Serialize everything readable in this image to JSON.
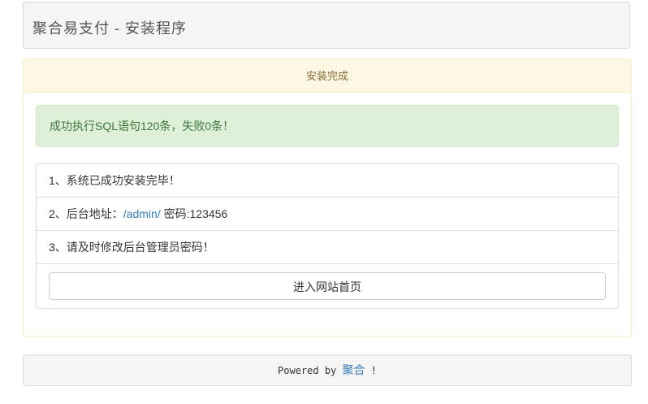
{
  "header": {
    "title": "聚合易支付 - 安装程序"
  },
  "panel": {
    "heading": "安装完成",
    "alert": "成功执行SQL语句120条，失败0条！",
    "items": [
      {
        "text": "1、系统已成功安装完毕！"
      },
      {
        "prefix": "2、后台地址：",
        "link": "/admin/",
        "suffix": " 密码:123456"
      },
      {
        "text": "3、请及时修改后台管理员密码！"
      }
    ],
    "button_label": "进入网站首页"
  },
  "footer": {
    "prefix": "Powered by ",
    "link": "聚合",
    "suffix": " !"
  },
  "colors": {
    "panel_heading_bg": "#fcf8e3",
    "panel_heading_text": "#8a6d3b",
    "alert_bg": "#dff0d8",
    "alert_text": "#3c763d",
    "link": "#337ab7"
  }
}
